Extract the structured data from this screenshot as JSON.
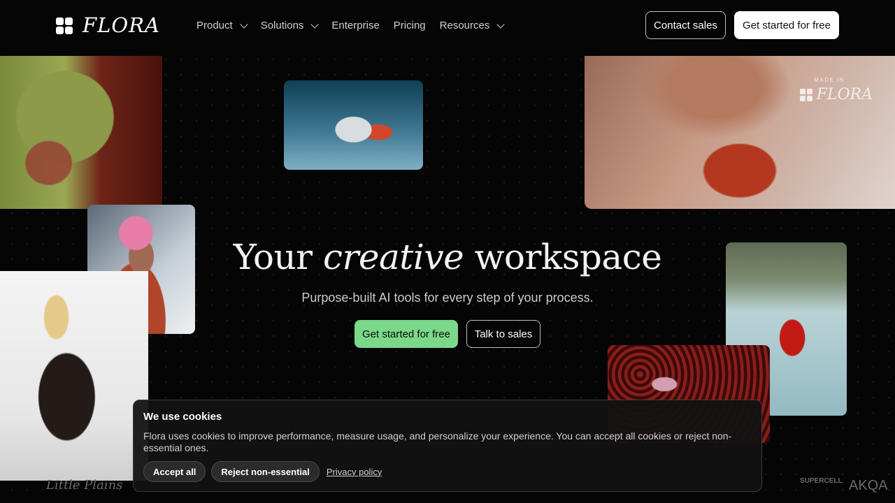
{
  "nav": {
    "brand": "FLORA",
    "menu": [
      "Product",
      "Solutions",
      "Enterprise",
      "Pricing",
      "Resources"
    ],
    "contact_label": "Contact sales",
    "start_label": "Get started for free"
  },
  "made_in": {
    "label": "MADE IN",
    "brand": "FLORA"
  },
  "hero": {
    "title_prefix": "Your",
    "title_em": "creative",
    "title_suffix": "workspace",
    "subtitle": "Purpose-built AI tools for every step of your process.",
    "primary_label": "Get started for free",
    "secondary_label": "Talk to sales",
    "primary_color": "#7bd88a"
  },
  "logos": [
    "Little Plains",
    "SUPERCELL",
    "AKQA"
  ],
  "cookie": {
    "title": "We use cookies",
    "text": "Flora uses cookies to improve performance, measure usage, and personalize your experience. You can accept all cookies or reject non-essential ones.",
    "accept_label": "Accept all",
    "reject_label": "Reject non-essential",
    "privacy_label": "Privacy policy"
  }
}
